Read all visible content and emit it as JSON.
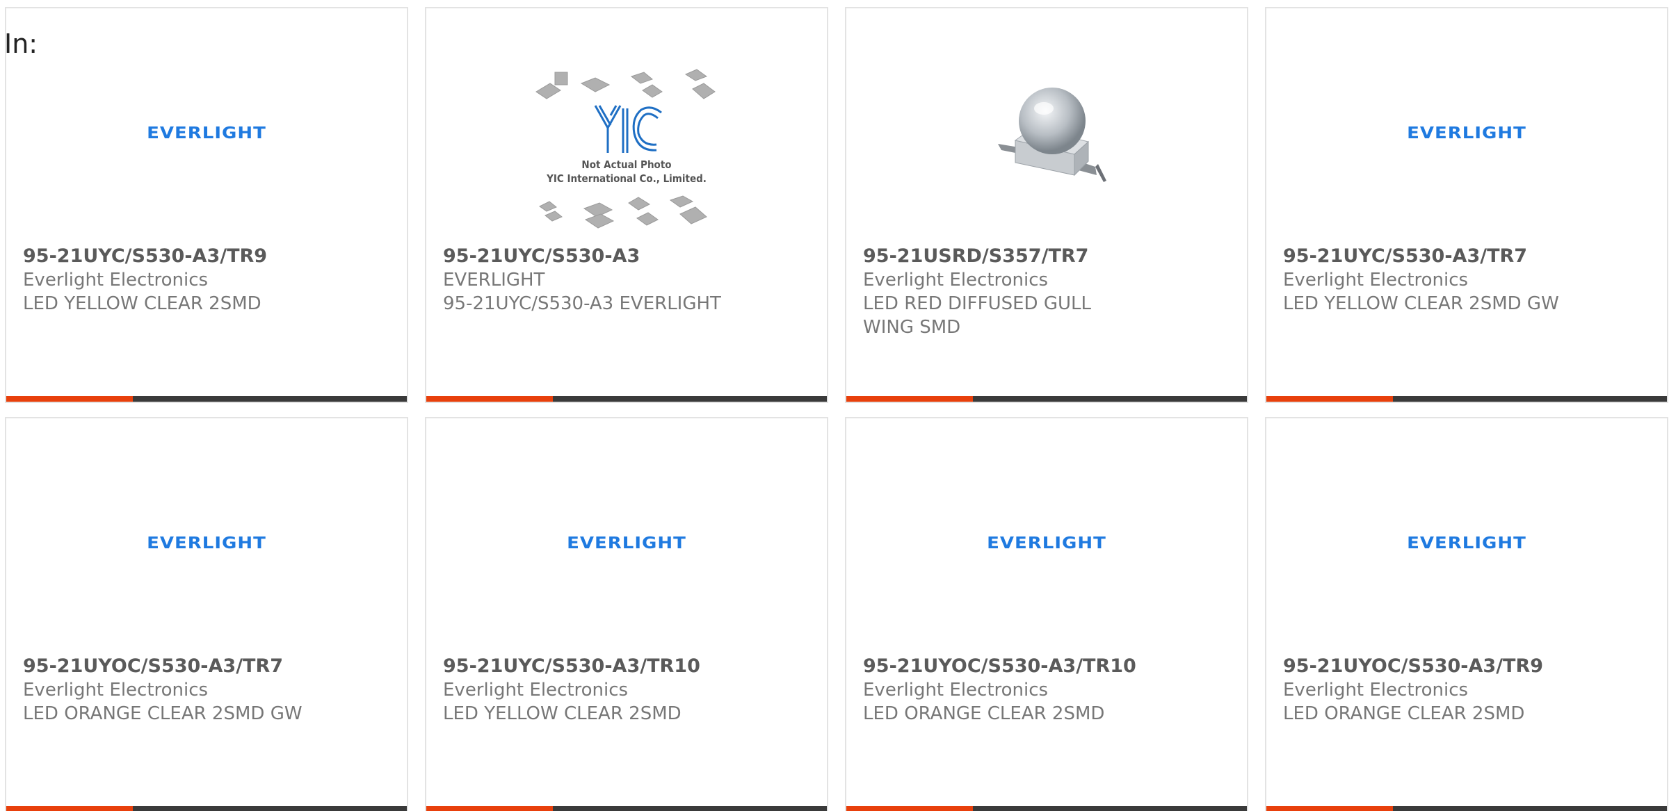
{
  "header": {
    "in_label": "In:"
  },
  "colors": {
    "accent": "#e8400c",
    "bar": "#3a3a3a",
    "logo_blue": "#1f7ae0"
  },
  "cards": [
    {
      "part": "95-21UYC/S530-A3/TR9",
      "mfr": "Everlight Electronics",
      "desc": "LED YELLOW CLEAR 2SMD",
      "image": "everlight-logo",
      "logo_text": "EVERLIGHT"
    },
    {
      "part": "95-21UYC/S530-A3",
      "mfr": "EVERLIGHT",
      "desc": "95-21UYC/S530-A3 EVERLIGHT",
      "image": "yic-placeholder",
      "image_text": [
        "Not Actual Photo",
        "YIC International Co., Limited."
      ]
    },
    {
      "part": "95-21USRD/S357/TR7",
      "mfr": "Everlight Electronics",
      "desc": "LED RED DIFFUSED GULL WING SMD",
      "image": "led-photo"
    },
    {
      "part": "95-21UYC/S530-A3/TR7",
      "mfr": "Everlight Electronics",
      "desc": "LED YELLOW CLEAR 2SMD GW",
      "image": "everlight-logo",
      "logo_text": "EVERLIGHT"
    },
    {
      "part": "95-21UYOC/S530-A3/TR7",
      "mfr": "Everlight Electronics",
      "desc": "LED ORANGE CLEAR 2SMD GW",
      "image": "everlight-logo",
      "logo_text": "EVERLIGHT"
    },
    {
      "part": "95-21UYC/S530-A3/TR10",
      "mfr": "Everlight Electronics",
      "desc": "LED YELLOW CLEAR 2SMD",
      "image": "everlight-logo",
      "logo_text": "EVERLIGHT"
    },
    {
      "part": "95-21UYOC/S530-A3/TR10",
      "mfr": "Everlight Electronics",
      "desc": "LED ORANGE CLEAR 2SMD",
      "image": "everlight-logo",
      "logo_text": "EVERLIGHT"
    },
    {
      "part": "95-21UYOC/S530-A3/TR9",
      "mfr": "Everlight Electronics",
      "desc": "LED ORANGE CLEAR 2SMD",
      "image": "everlight-logo",
      "logo_text": "EVERLIGHT"
    }
  ]
}
